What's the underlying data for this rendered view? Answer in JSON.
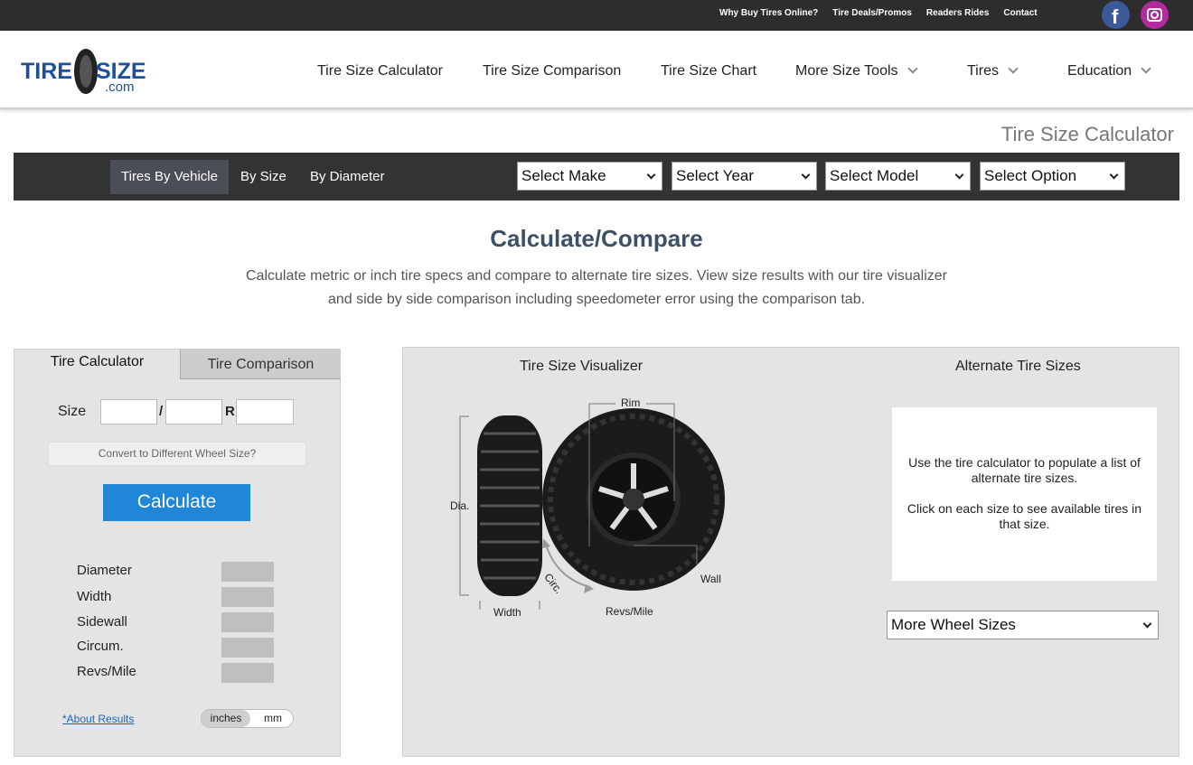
{
  "topbar": {
    "links": [
      "Why Buy Tires Online?",
      "Tire Deals/Promos",
      "Readers Rides",
      "Contact"
    ],
    "social": [
      "facebook-icon",
      "instagram-icon"
    ]
  },
  "logo": {
    "text_main_left": "TIRE",
    "text_main_right": "SIZE",
    "text_sub": ".com"
  },
  "nav": {
    "tire_size_calculator": "Tire Size Calculator",
    "tire_size_comparison": "Tire Size Comparison",
    "tire_size_chart": "Tire Size Chart",
    "more_size_tools": "More Size Tools",
    "tires": "Tires",
    "education": "Education"
  },
  "page_title": "Tire Size Calculator",
  "vehicle_bar": {
    "tabs": [
      "Tires By Vehicle",
      "By Size",
      "By Diameter"
    ],
    "active_tab": "Tires By Vehicle",
    "selects": [
      "Select Make",
      "Select Year",
      "Select Model",
      "Select Option"
    ]
  },
  "heading": "Calculate/Compare",
  "intro_line1": "Calculate metric or inch tire specs and compare to alternate tire sizes. View size results with our tire visualizer",
  "intro_line2": "and side by side comparison including speedometer error using the comparison tab.",
  "calculator": {
    "tab_active": "Tire Calculator",
    "tab_inactive": "Tire Comparison",
    "size_label": "Size",
    "sep_slash": "/",
    "sep_r": "R",
    "width_value": "",
    "aspect_value": "",
    "rim_value": "",
    "convert_label": "Convert to Different Wheel Size?",
    "calculate_label": "Calculate",
    "results": [
      "Diameter",
      "Width",
      "Sidewall",
      "Circum.",
      "Revs/Mile"
    ],
    "about_link": "*About Results",
    "unit_inches": "inches",
    "unit_mm": "mm"
  },
  "visualizer": {
    "title": "Tire Size Visualizer",
    "labels": {
      "rim": "Rim",
      "dia": "Dia.",
      "width": "Width",
      "circ": "Circ.",
      "wall": "Wall",
      "revs": "Revs/Mile"
    }
  },
  "alternate": {
    "title": "Alternate Tire Sizes",
    "text1": "Use the tire calculator to populate a list of alternate tire sizes.",
    "text2": "Click on each size to see available tires in that size.",
    "wheel_select": "More Wheel Sizes"
  },
  "colors": {
    "accent": "#1f86d8",
    "heading": "#3d5166",
    "dark_bar": "#333333"
  }
}
